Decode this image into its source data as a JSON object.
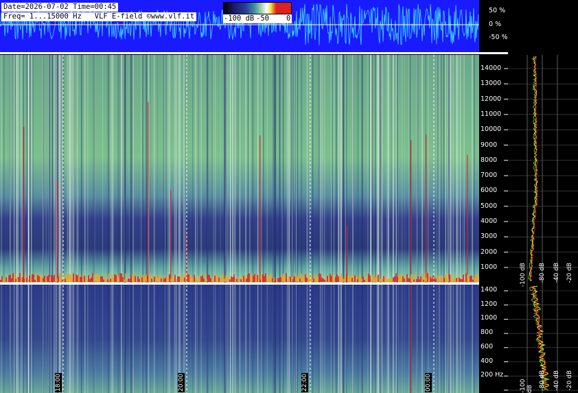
{
  "header": {
    "line1": "Date=2026-07-02 Time=00:45",
    "line2": "Freq= 1...15000 Hz   VLF E-field ©www.vlf.it"
  },
  "color_scale": {
    "labels": [
      "-100 dB",
      "-50",
      "0"
    ]
  },
  "waveform_axis": {
    "labels": [
      "50 %",
      "0 %",
      "-50 %"
    ]
  },
  "upper_freq_axis": {
    "labels": [
      "14000",
      "13000",
      "12000",
      "11000",
      "10000",
      "9000",
      "8000",
      "7000",
      "6000",
      "5000",
      "4000",
      "3000",
      "2000",
      "1000"
    ]
  },
  "lower_freq_axis": {
    "labels": [
      "1400",
      "1200",
      "1000",
      "800",
      "600",
      "400",
      "200 Hz"
    ]
  },
  "spectrum_db_labels": [
    "-100 dB",
    "-80 dB",
    "-40 dB",
    "-20 dB"
  ],
  "time_labels": [
    "18:00",
    "20:00",
    "22:00",
    "00:00"
  ],
  "colors": {
    "waveform_bg": "#1a1aff",
    "waveform_trace": "#40e0ff",
    "spectrum_green": "#7ac08a",
    "spectrum_blue": "#2a3a8a",
    "spike_red": "#e02020",
    "trace_yellow": "#f0f020"
  }
}
